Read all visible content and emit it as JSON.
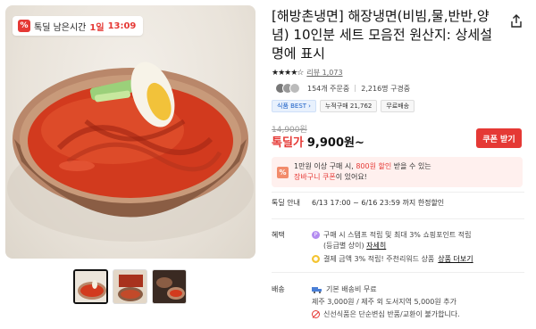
{
  "badge": {
    "icon": "%",
    "label": "톡딜 남은시간",
    "days": "1일",
    "time": "13:09"
  },
  "product": {
    "title": "[해방촌냉면] 해장냉면(비빔,물,반반,양념) 10인분 세트 모음전 원산지: 상세설명에 표시",
    "stars": "★★★★☆",
    "review_label": "리뷰",
    "review_count": "1,073",
    "orders": "154개 주문중",
    "interest": "2,216명 구경중",
    "tags": [
      {
        "label": "식품 BEST",
        "chevron": "›"
      },
      {
        "label": "누적구매 21,762"
      },
      {
        "label": "무료배송"
      }
    ],
    "original_price": "14,900원",
    "price_label": "톡딜가",
    "price": "9,900원~",
    "coupon_button": "쿠폰 받기"
  },
  "promo": {
    "icon": "%",
    "line1_pre": "1만원 이상 구매 시, ",
    "line1_hl": "800원 할인",
    "line1_post": " 받을 수 있는",
    "line2_hl": "장바구니 쿠폰",
    "line2_post": "이 있어요!"
  },
  "sale_info": {
    "label": "톡딜 안내",
    "value": "6/13 17:00 ~ 6/16 23:59 까지 한정할인"
  },
  "benefit": {
    "label": "혜택",
    "item1_line1": "구매 시 스탬프 적립 및 최대 3% 쇼핑포인트 적립",
    "item1_line2": "(등급별 상이)",
    "item1_link": "자세히",
    "item2_text": "결제 금액 3% 적립! 주천리워드 상품",
    "item2_link": "상품 더보기"
  },
  "shipping": {
    "label": "배송",
    "line1": "기본 배송비 무료",
    "line2": "제주 3,000원 / 제주 외 도서지역 5,000원 추가",
    "line3": "신선식품은 단순변심 반품/교환이 불가합니다."
  },
  "colors": {
    "accent": "#e53935",
    "promo_bg": "#fff0ee"
  }
}
